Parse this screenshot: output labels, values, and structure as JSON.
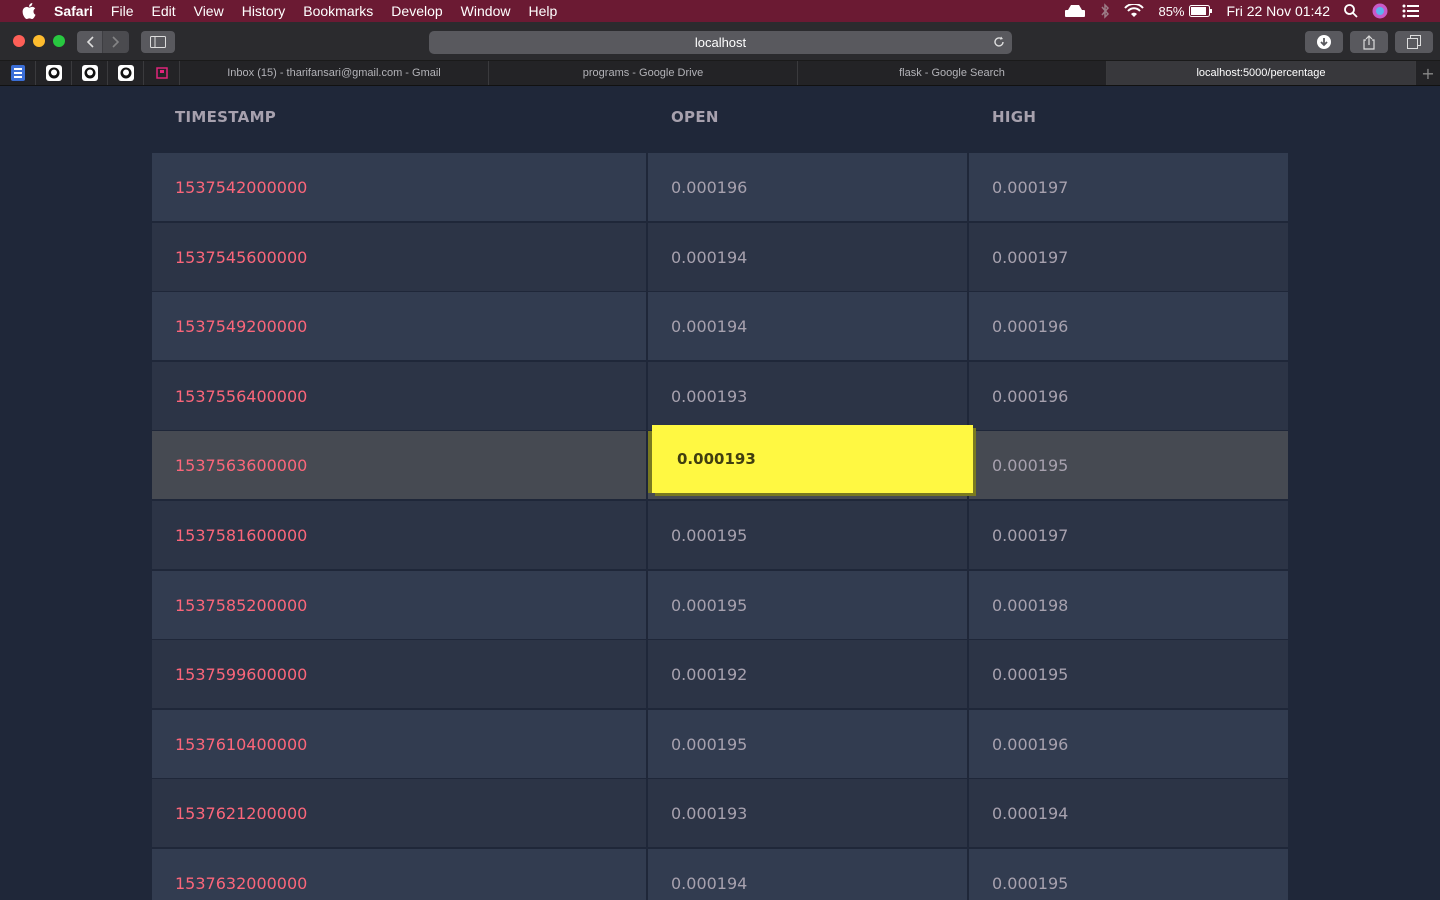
{
  "menubar": {
    "app": "Safari",
    "items": [
      "File",
      "Edit",
      "View",
      "History",
      "Bookmarks",
      "Develop",
      "Window",
      "Help"
    ],
    "battery": "85%",
    "clock": "Fri 22 Nov  01:42"
  },
  "browser": {
    "url": "localhost",
    "tabs": [
      {
        "label": "Inbox (15) - tharifansari@gmail.com - Gmail",
        "active": false
      },
      {
        "label": "programs - Google Drive",
        "active": false
      },
      {
        "label": "flask - Google Search",
        "active": false
      },
      {
        "label": "localhost:5000/percentage",
        "active": true
      }
    ],
    "new_tab_symbol": "+"
  },
  "table": {
    "headers": {
      "timestamp": "TIMESTAMP",
      "open": "OPEN",
      "high": "HIGH"
    },
    "rows": [
      {
        "timestamp": "1537542000000",
        "open": "0.000196",
        "high": "0.000197"
      },
      {
        "timestamp": "1537545600000",
        "open": "0.000194",
        "high": "0.000197"
      },
      {
        "timestamp": "1537549200000",
        "open": "0.000194",
        "high": "0.000196"
      },
      {
        "timestamp": "1537556400000",
        "open": "0.000193",
        "high": "0.000196"
      },
      {
        "timestamp": "1537563600000",
        "open": "0.000193",
        "high": "0.000195"
      },
      {
        "timestamp": "1537581600000",
        "open": "0.000195",
        "high": "0.000197"
      },
      {
        "timestamp": "1537585200000",
        "open": "0.000195",
        "high": "0.000198"
      },
      {
        "timestamp": "1537599600000",
        "open": "0.000192",
        "high": "0.000195"
      },
      {
        "timestamp": "1537610400000",
        "open": "0.000195",
        "high": "0.000196"
      },
      {
        "timestamp": "1537621200000",
        "open": "0.000193",
        "high": "0.000194"
      },
      {
        "timestamp": "1537632000000",
        "open": "0.000194",
        "high": "0.000195"
      }
    ],
    "hovered_row": 4,
    "highlighted_cell_value": "0.000193"
  },
  "colors": {
    "menubar": "#6b1a33",
    "page_bg": "#1f2739",
    "timestamp_text": "#fb667a",
    "value_text": "#a7a1ae",
    "highlight": "#fff842"
  }
}
